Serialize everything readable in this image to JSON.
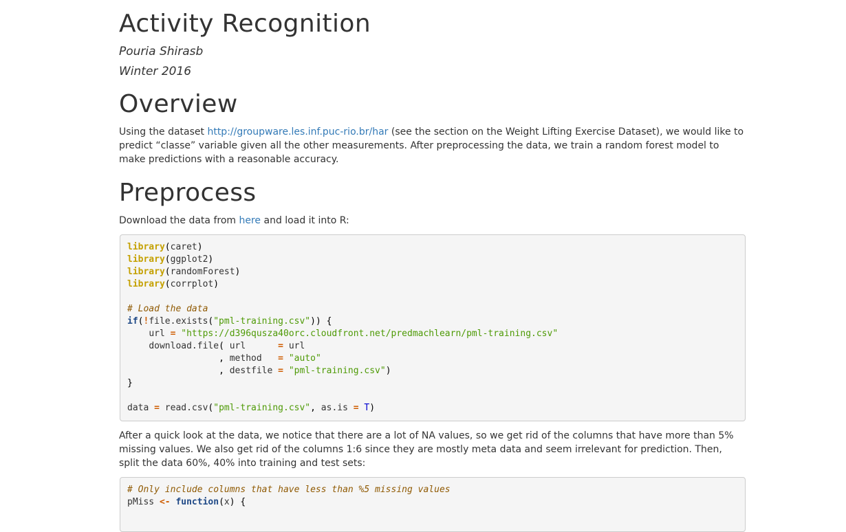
{
  "header": {
    "title": "Activity Recognition",
    "author": "Pouria Shirasb",
    "date": "Winter 2016"
  },
  "overview": {
    "heading": "Overview",
    "text_before": "Using the dataset ",
    "link": "http://groupware.les.inf.puc-rio.br/har",
    "text_after_line1": " (see the section on the Weight Lifting Exercise Dataset), we would like to",
    "text_line2": "predict “classe” variable given all the other measurements. After preprocessing the data, we train a random forest model to",
    "text_line3": "make predictions with a reasonable accuracy."
  },
  "preprocess": {
    "heading": "Preprocess",
    "download_before": "Download the data from ",
    "download_link": "here",
    "download_after": " and load it into R:",
    "after_line1": "After a quick look at the data, we notice that there are a lot of NA values, so we get rid of the columns that have more than 5%",
    "after_line2": "missing values. We also get rid of the columns 1:6 since they are mostly meta data and seem irrelevant for prediction. Then,",
    "after_line3": "split the data 60%, 40% into training and test sets:"
  },
  "code": {
    "kw_library": "library",
    "pkg1": "caret",
    "pkg2": "ggplot2",
    "pkg3": "randomForest",
    "pkg4": "corrplot",
    "comment_load": "# Load the data",
    "kw_if": "if",
    "fn_file_exists": "file.exists",
    "str_csv": "\"pml-training.csv\"",
    "var_url": "url",
    "str_url": "\"https://d396qusza40orc.cloudfront.net/predmachlearn/pml-training.csv\"",
    "fn_download": "download.file",
    "arg_url": "url",
    "arg_method": "method",
    "str_auto": "\"auto\"",
    "arg_destfile": "destfile",
    "var_data": "data",
    "fn_read_csv": "read.csv",
    "arg_as_is": "as.is",
    "const_T": "T",
    "comment_missing": "# Only include columns that have less than %5 missing values",
    "var_pmiss": "pMiss",
    "kw_function": "function",
    "arg_x": "x"
  }
}
